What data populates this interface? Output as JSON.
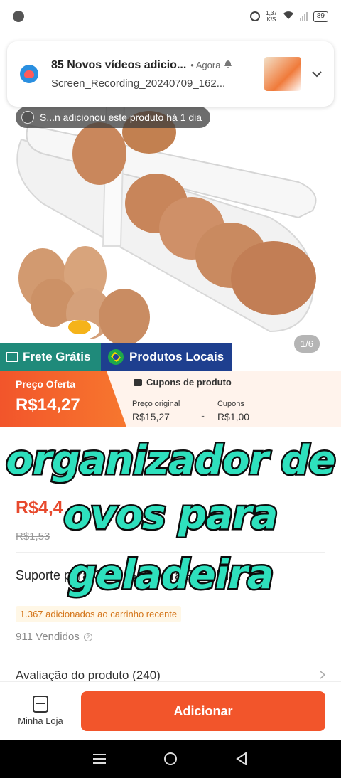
{
  "status_bar": {
    "speed_value": "1,37",
    "speed_unit": "K/S",
    "battery": "89"
  },
  "notification": {
    "title": "85 Novos vídeos adicio...",
    "time": "• Agora",
    "body": "Screen_Recording_20240709_162..."
  },
  "product_image": {
    "added_text": "S...n adicionou este produto há 1 dia",
    "counter": "1/6"
  },
  "badges": {
    "frete": "Frete Grátis",
    "locais": "Produtos Locais"
  },
  "price_banner": {
    "oferta_label": "Preço Oferta",
    "oferta_value": "R$14,27",
    "coupon_header": "Cupons de produto",
    "original_label": "Preço original",
    "original_value": "R$15,27",
    "minus": "-",
    "cupons_label": "Cupons",
    "cupons_value": "R$1,00"
  },
  "product_info": {
    "partial_price": "R$4,4",
    "old_price": "R$1,53",
    "title": "Suporte para Ovos Geladeira Prateleira",
    "cart_note": "1.367 adicionados ao carrinho recente",
    "sold": "911 Vendidos",
    "reviews": "Avaliação do produto (240)"
  },
  "caption": {
    "line1": "organizador de",
    "line2": "ovos para",
    "line3": "geladeira"
  },
  "bottom_bar": {
    "store_label": "Minha Loja",
    "add_label": "Adicionar"
  },
  "colors": {
    "accent_orange": "#f2552b",
    "frete_green": "#1f8a7a",
    "locais_blue": "#1e3f8f",
    "caption_fill": "#2ee0bd"
  }
}
